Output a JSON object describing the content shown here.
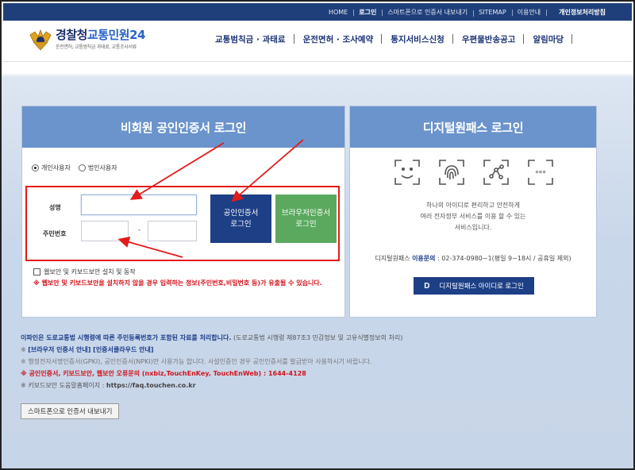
{
  "topbar": {
    "items": [
      "HOME",
      "로그인",
      "스마트폰으로 인증서 내보내기",
      "SITEMAP",
      "이용안내"
    ],
    "active": "로그인",
    "privacy": "개인정보처리방침"
  },
  "header": {
    "logo_title_a": "경찰청",
    "logo_title_b": "교통민원24",
    "logo_sub": "운전면허, 교통범칙금 과태료, 교통조사서류",
    "menu": [
      "교통범칙금 · 과태료",
      "운전면허 · 조사예약",
      "통지서비스신청",
      "우편물반송공고",
      "알림마당"
    ]
  },
  "nonmember": {
    "title": "비회원 공인인증서 로그인",
    "radio_personal": "개인사용자",
    "radio_corporate": "법인사용자",
    "name_label": "성명",
    "rrn_label": "주민번호",
    "dash": "-",
    "cert_button": "공인인증서\n로그인",
    "browser_button": "브라우저인증서\n로그인",
    "security_check": "웹보안 및 키보드보안 설치 및 동작",
    "warning": "※ 웹보안 및 키보드보안을 설치하지 않을 경우 입력하는 정보(주민번호,비밀번호 등)가 유출될 수 있습니다."
  },
  "digital": {
    "title": "디지털원패스 로그인",
    "icons": [
      "face-id-icon",
      "fingerprint-icon",
      "pattern-icon",
      "pin-icon"
    ],
    "desc": "하나의 아이디로 편리하고 안전하게\n여러 전자정부 서비스를 이용 할 수 있는\n서비스입니다.",
    "contact_prefix": "디지털원패스 ",
    "contact_strong": "이용문의",
    "contact_rest": " : 02-374-0980~1(평일 9~18시 / 공휴일 제외)",
    "button_mark": "D",
    "button_label": "디지털원패스 아이디로 로그인"
  },
  "notices": {
    "n1_bold": "이파인은 도로교통법 시행령에 따른 주민등록번호가 포함된 자료를 처리합니다.",
    "n1_plain": " (도로교통법 시행령 제87조3 민감정보 및 고유식별정보의 처리)",
    "n2_mark": "※ ",
    "n2_text": "[브라우저 인증서 안내] [인증서클라우드 안내]",
    "n3": "※ 행정전자서명인증서(GPKI), 공인인증서(NPKI)만 사용가능 합니다. 사설인증인 경우 공인인증서를 발급받아 사용하시기 바랍니다.",
    "n4": "※ 공인인증서, 키보드보안, 웹보안 오류문의 (nxbiz,TouchEnKey, TouchEnWeb) : 1644-4128",
    "n5_prefix": "※ 키보드보안 도움말홈페이지 : ",
    "n5_url": "https://faq.touchen.co.kr",
    "export_button": "스마트폰으로 인증서 내보내기"
  },
  "colors": {
    "topbar": "#1f3f7a",
    "panel_header": "#6b93cc",
    "primary_button": "#1d3f86",
    "browser_button": "#5ba95f",
    "warning_red": "#d3141c",
    "annotation_red": "#e21b1b"
  }
}
